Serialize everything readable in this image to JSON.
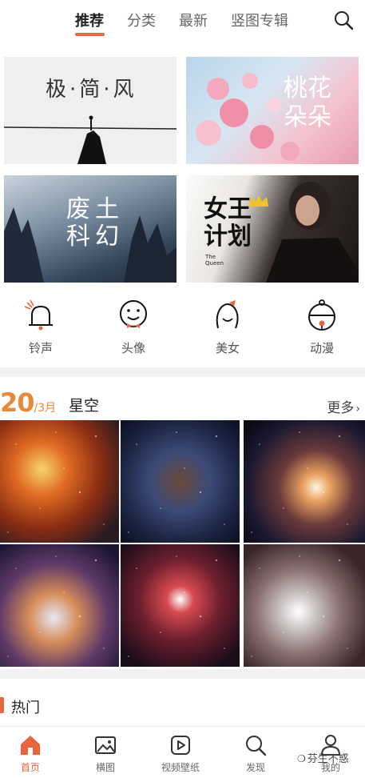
{
  "top_tabs": [
    "推荐",
    "分类",
    "最新",
    "竖图专辑"
  ],
  "banners": [
    {
      "title": "极·简·风"
    },
    {
      "title": "桃花朵朵"
    },
    {
      "title": "废土科幻"
    },
    {
      "title": "女王计划",
      "subtitle": "The Queen"
    }
  ],
  "categories": [
    "铃声",
    "头像",
    "美女",
    "动漫"
  ],
  "daily": {
    "day": "20",
    "month": "/3月",
    "title": "星空",
    "more": "更多"
  },
  "hot": {
    "title": "热门"
  },
  "bottom_nav": [
    "首页",
    "横图",
    "视频壁纸",
    "发现",
    "我的"
  ],
  "watermark": "芬生不惑",
  "colors": {
    "accent": "#e8663d",
    "date": "#e8883d"
  }
}
